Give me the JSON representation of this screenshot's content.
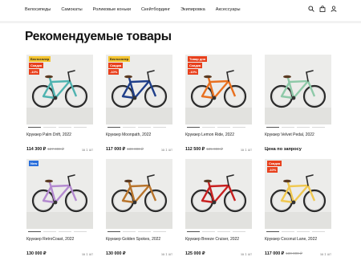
{
  "nav": {
    "items": [
      "Велосипеды",
      "Самокаты",
      "Роликовые коньки",
      "Скейтбординг",
      "Экипировка",
      "Аксессуары"
    ]
  },
  "header": {
    "icons": [
      "search-icon",
      "bag-icon",
      "user-icon"
    ]
  },
  "page_title": "Рекомендуемые товары",
  "products": [
    {
      "name": "Круизер Palm Drift, 2022",
      "price": "114 300 ₽",
      "old_price": "127 000 ₽",
      "unit": "за 1 шт",
      "badges": [
        {
          "text": "Бестселлер",
          "color": "yellow"
        },
        {
          "text": "Скидка",
          "color": "red"
        },
        {
          "text": "-10%",
          "color": "red"
        }
      ],
      "frame_color": "#4fb3b0"
    },
    {
      "name": "Круизер Moonpath, 2022",
      "price": "117 000 ₽",
      "old_price": "130 000 ₽",
      "unit": "за 1 шт",
      "badges": [
        {
          "text": "Бестселлер",
          "color": "yellow"
        },
        {
          "text": "Скидка",
          "color": "red"
        },
        {
          "text": "-10%",
          "color": "red"
        }
      ],
      "frame_color": "#1f3f8a"
    },
    {
      "name": "Круизер Lemon Ride, 2022",
      "price": "112 500 ₽",
      "old_price": "125 000 ₽",
      "unit": "за 1 шт",
      "badges": [
        {
          "text": "Товар дня",
          "color": "red"
        },
        {
          "text": "Скидка",
          "color": "red"
        },
        {
          "text": "-10%",
          "color": "red"
        }
      ],
      "frame_color": "#e8701f"
    },
    {
      "name": "Круизер Velvet Pedal, 2022",
      "price": "Цена по запросу",
      "old_price": "",
      "unit": "",
      "badges": [],
      "frame_color": "#8ec9a8"
    },
    {
      "name": "Круизер RetroCoast, 2022",
      "price": "130 000 ₽",
      "old_price": "",
      "unit": "за 1 шт",
      "badges": [
        {
          "text": "New",
          "color": "blue"
        }
      ],
      "frame_color": "#b48ad0"
    },
    {
      "name": "Круизер Golden Spokes, 2022",
      "price": "130 000 ₽",
      "old_price": "",
      "unit": "за 1 шт",
      "badges": [],
      "frame_color": "#b8742c"
    },
    {
      "name": "Круизер Breeze Cruiser, 2022",
      "price": "125 000 ₽",
      "old_price": "",
      "unit": "за 1 шт",
      "badges": [],
      "frame_color": "#c82020"
    },
    {
      "name": "Круизер Coconut Lane, 2022",
      "price": "117 000 ₽",
      "old_price": "130 000 ₽",
      "unit": "за 1 шт",
      "badges": [
        {
          "text": "Скидка",
          "color": "red"
        },
        {
          "text": "-10%",
          "color": "red"
        }
      ],
      "frame_color": "#f0c850"
    }
  ]
}
